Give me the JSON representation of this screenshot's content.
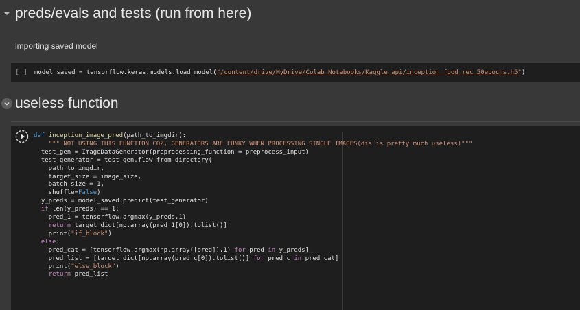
{
  "sections": {
    "preds_heading": "preds/evals and tests (run from here)",
    "useless_heading": "useless function"
  },
  "text_cell": "importing saved model",
  "cell1": {
    "bracket": "[ ]",
    "code_before": "model_saved = tensorflow.keras.models.load_model(",
    "path": "\"/content/drive/MyDrive/Colab Notebooks/Kaggle api/inception_food_rec_50epochs.h5\"",
    "code_after": ")"
  },
  "cell2": {
    "lines": [
      "def inception_image_pred(path_to_imgdir):",
      "    \"\"\" NOT USING THIS FUNCTION COZ, GENERATORS ARE FUNKY WHEN PROCESSING SINGLE IMAGES(dis is pretty much useless)\"\"\"",
      "  test_gen = ImageDataGenerator(preprocessing_function = preprocess_input)",
      "  test_generator = test_gen.flow_from_directory(",
      "    path_to_imgdir,",
      "    target_size = image_size,",
      "    batch_size = 1,",
      "    shuffle=False)",
      "  y_preds = model_saved.predict(test_generator)",
      "  if len(y_preds) == 1:",
      "    pred_1 = tensorflow.argmax(y_preds,1)",
      "    return target_dict[np.array(pred_1[0]).tolist()]",
      "    print(\"if_block\")",
      "  else:",
      "    pred_cat = [tensorflow.argmax(np.array([pred]),1) for pred in y_preds]",
      "    pred_list = [target_dict[np.array(pred_c[0]).tolist()] for pred_c in pred_cat]",
      "    print(\"else_block\")",
      "    return pred_list"
    ]
  },
  "icons": {
    "toggle": "chevron-down-icon",
    "run": "play-circle-icon"
  },
  "colors": {
    "background": "#383838",
    "code_bg": "#1e1e1e",
    "string": "#ce9178",
    "keyword": "#c586c0"
  }
}
